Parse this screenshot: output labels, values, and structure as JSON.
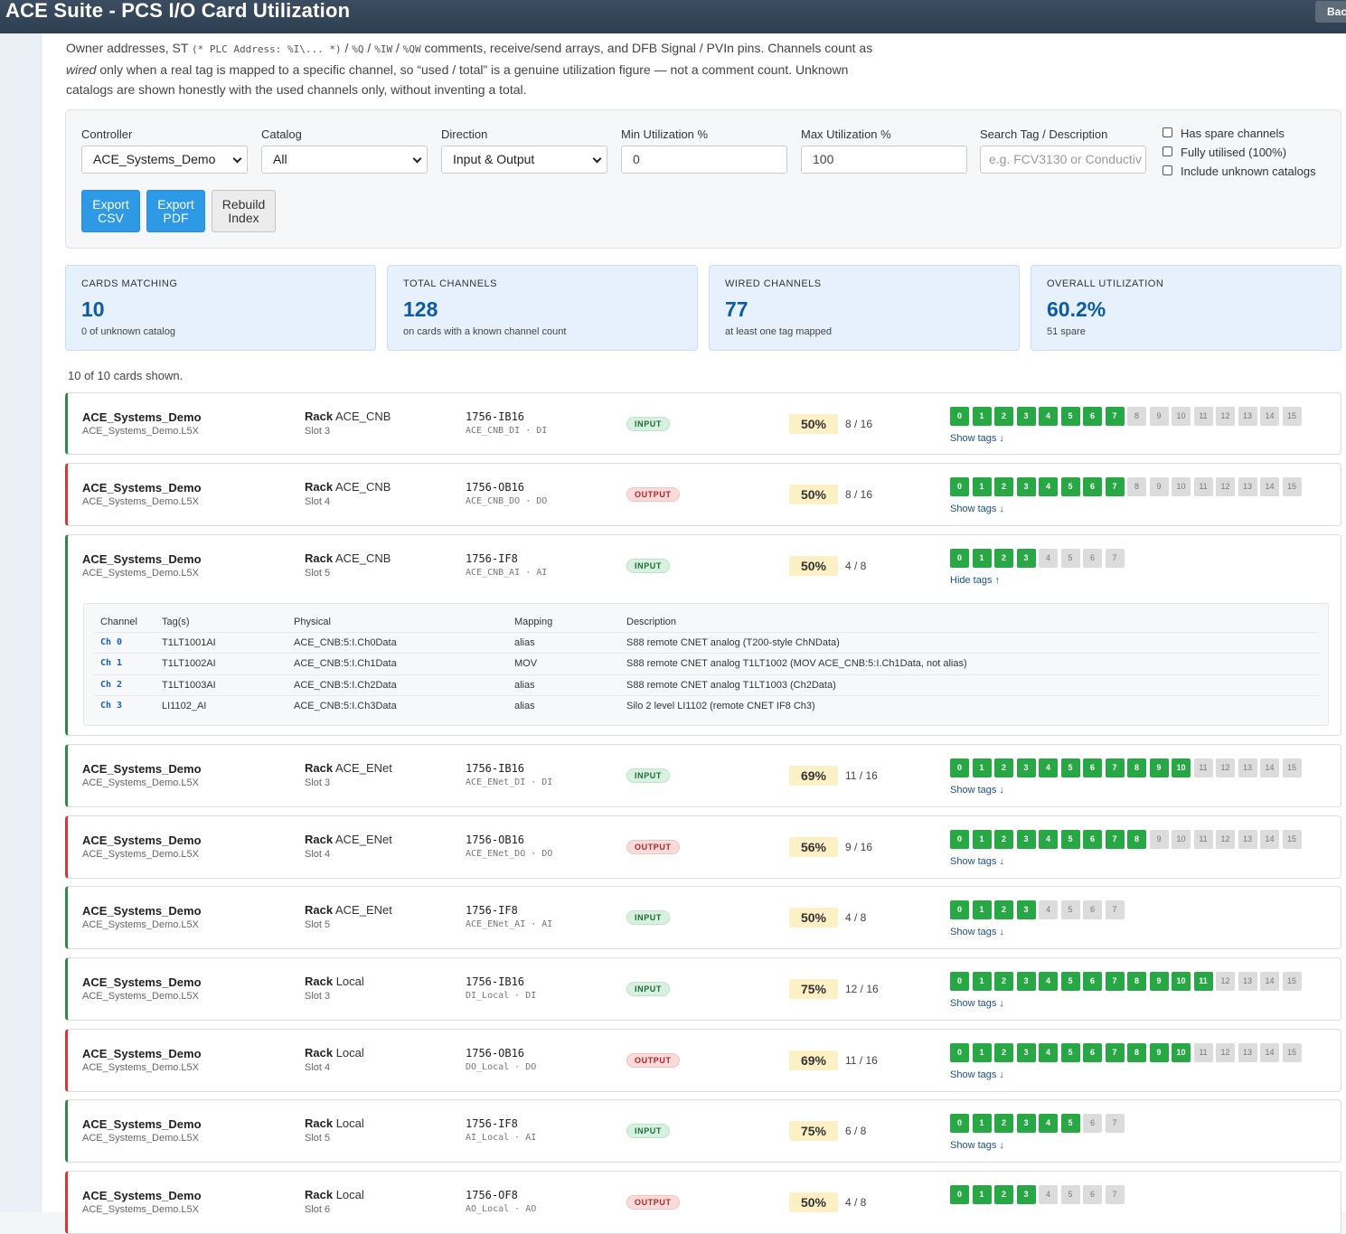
{
  "window": {
    "title": "ACE Suite - PCS I/O Card Utilization",
    "back_label": "Bac"
  },
  "intro": {
    "line1a": "Owner addresses, ST ",
    "code1": "(* PLC Address: %I\\... *)",
    "sep1": " / ",
    "code2": "%Q",
    "sep2": " / ",
    "code3": "%IW",
    "sep3": " / ",
    "code4": "%QW",
    "line1b": " comments, receive/send arrays, and DFB Signal / PVIn pins. Channels count as",
    "wired_word": "wired",
    "line2": " only when a real tag is mapped to a specific channel, so “used / total” is a genuine utilization figure — not a comment count. Unknown",
    "line3": "catalogs are shown honestly with the used channels only, without inventing a total."
  },
  "filters": {
    "controller": {
      "label": "Controller",
      "value": "ACE_Systems_Demo"
    },
    "catalog": {
      "label": "Catalog",
      "value": "All"
    },
    "direction": {
      "label": "Direction",
      "value": "Input & Output"
    },
    "min_util": {
      "label": "Min Utilization %",
      "value": "0"
    },
    "max_util": {
      "label": "Max Utilization %",
      "value": "100"
    },
    "search": {
      "label": "Search Tag / Description",
      "placeholder": "e.g. FCV3130 or Conductiv"
    },
    "checks": [
      "Has spare channels",
      "Fully utilised (100%)",
      "Include unknown catalogs"
    ],
    "buttons": {
      "export_csv": [
        "Export",
        "CSV"
      ],
      "export_pdf": [
        "Export",
        "PDF"
      ],
      "rebuild": [
        "Rebuild",
        "Index"
      ]
    }
  },
  "stats": [
    {
      "key": "CARDS MATCHING",
      "value": "10",
      "sub": "0 of unknown catalog"
    },
    {
      "key": "TOTAL CHANNELS",
      "value": "128",
      "sub": "on cards with a known channel count"
    },
    {
      "key": "WIRED CHANNELS",
      "value": "77",
      "sub": "at least one tag mapped"
    },
    {
      "key": "OVERALL UTILIZATION",
      "value": "60.2%",
      "sub": "51 spare"
    }
  ],
  "shown_text": "10 of 10 cards shown.",
  "rack_word": "Rack",
  "cards": [
    {
      "controller": "ACE_Systems_Demo",
      "file": "ACE_Systems_Demo.L5X",
      "rack": "ACE_CNB",
      "slot": "Slot 3",
      "catalog": "1756-IB16",
      "tagline": "ACE_CNB_DI · DI",
      "direction": "INPUT",
      "pct": "50%",
      "frac": "8 / 16",
      "total": 16,
      "used": 8,
      "toggle": "Show tags ↓"
    },
    {
      "controller": "ACE_Systems_Demo",
      "file": "ACE_Systems_Demo.L5X",
      "rack": "ACE_CNB",
      "slot": "Slot 4",
      "catalog": "1756-OB16",
      "tagline": "ACE_CNB_DO · DO",
      "direction": "OUTPUT",
      "pct": "50%",
      "frac": "8 / 16",
      "total": 16,
      "used": 8,
      "toggle": "Show tags ↓"
    },
    {
      "controller": "ACE_Systems_Demo",
      "file": "ACE_Systems_Demo.L5X",
      "rack": "ACE_CNB",
      "slot": "Slot 5",
      "catalog": "1756-IF8",
      "tagline": "ACE_CNB_AI · AI",
      "direction": "INPUT",
      "pct": "50%",
      "frac": "4 / 8",
      "total": 8,
      "used": 4,
      "toggle": "Hide tags ↑"
    },
    {
      "controller": "ACE_Systems_Demo",
      "file": "ACE_Systems_Demo.L5X",
      "rack": "ACE_ENet",
      "slot": "Slot 3",
      "catalog": "1756-IB16",
      "tagline": "ACE_ENet_DI · DI",
      "direction": "INPUT",
      "pct": "69%",
      "frac": "11 / 16",
      "total": 16,
      "used": 11,
      "toggle": "Show tags ↓"
    },
    {
      "controller": "ACE_Systems_Demo",
      "file": "ACE_Systems_Demo.L5X",
      "rack": "ACE_ENet",
      "slot": "Slot 4",
      "catalog": "1756-OB16",
      "tagline": "ACE_ENet_DO · DO",
      "direction": "OUTPUT",
      "pct": "56%",
      "frac": "9 / 16",
      "total": 16,
      "used": 9,
      "toggle": "Show tags ↓"
    },
    {
      "controller": "ACE_Systems_Demo",
      "file": "ACE_Systems_Demo.L5X",
      "rack": "ACE_ENet",
      "slot": "Slot 5",
      "catalog": "1756-IF8",
      "tagline": "ACE_ENet_AI · AI",
      "direction": "INPUT",
      "pct": "50%",
      "frac": "4 / 8",
      "total": 8,
      "used": 4,
      "toggle": "Show tags ↓"
    },
    {
      "controller": "ACE_Systems_Demo",
      "file": "ACE_Systems_Demo.L5X",
      "rack": "Local",
      "slot": "Slot 3",
      "catalog": "1756-IB16",
      "tagline": "DI_Local · DI",
      "direction": "INPUT",
      "pct": "75%",
      "frac": "12 / 16",
      "total": 16,
      "used": 12,
      "toggle": "Show tags ↓"
    },
    {
      "controller": "ACE_Systems_Demo",
      "file": "ACE_Systems_Demo.L5X",
      "rack": "Local",
      "slot": "Slot 4",
      "catalog": "1756-OB16",
      "tagline": "DO_Local · DO",
      "direction": "OUTPUT",
      "pct": "69%",
      "frac": "11 / 16",
      "total": 16,
      "used": 11,
      "toggle": "Show tags ↓"
    },
    {
      "controller": "ACE_Systems_Demo",
      "file": "ACE_Systems_Demo.L5X",
      "rack": "Local",
      "slot": "Slot 5",
      "catalog": "1756-IF8",
      "tagline": "AI_Local · AI",
      "direction": "INPUT",
      "pct": "75%",
      "frac": "6 / 8",
      "total": 8,
      "used": 6,
      "toggle": "Show tags ↓"
    },
    {
      "controller": "ACE_Systems_Demo",
      "file": "ACE_Systems_Demo.L5X",
      "rack": "Local",
      "slot": "Slot 6",
      "catalog": "1756-OF8",
      "tagline": "AO_Local · AO",
      "direction": "OUTPUT",
      "pct": "50%",
      "frac": "4 / 8",
      "total": 8,
      "used": 4,
      "toggle": ""
    }
  ],
  "tag_table": {
    "headers": [
      "Channel",
      "Tag(s)",
      "Physical",
      "Mapping",
      "Description"
    ],
    "rows": [
      [
        "Ch 0",
        "T1LT1001AI",
        "ACE_CNB:5:I.Ch0Data",
        "alias",
        "S88 remote CNET analog (T200-style ChNData)"
      ],
      [
        "Ch 1",
        "T1LT1002AI",
        "ACE_CNB:5:I.Ch1Data",
        "MOV",
        "S88 remote CNET analog T1LT1002 (MOV ACE_CNB:5:I.Ch1Data, not alias)"
      ],
      [
        "Ch 2",
        "T1LT1003AI",
        "ACE_CNB:5:I.Ch2Data",
        "alias",
        "S88 remote CNET analog T1LT1003 (Ch2Data)"
      ],
      [
        "Ch 3",
        "LI1102_AI",
        "ACE_CNB:5:I.Ch3Data",
        "alias",
        "Silo 2 level LI1102 (remote CNET IF8 Ch3)"
      ]
    ]
  }
}
